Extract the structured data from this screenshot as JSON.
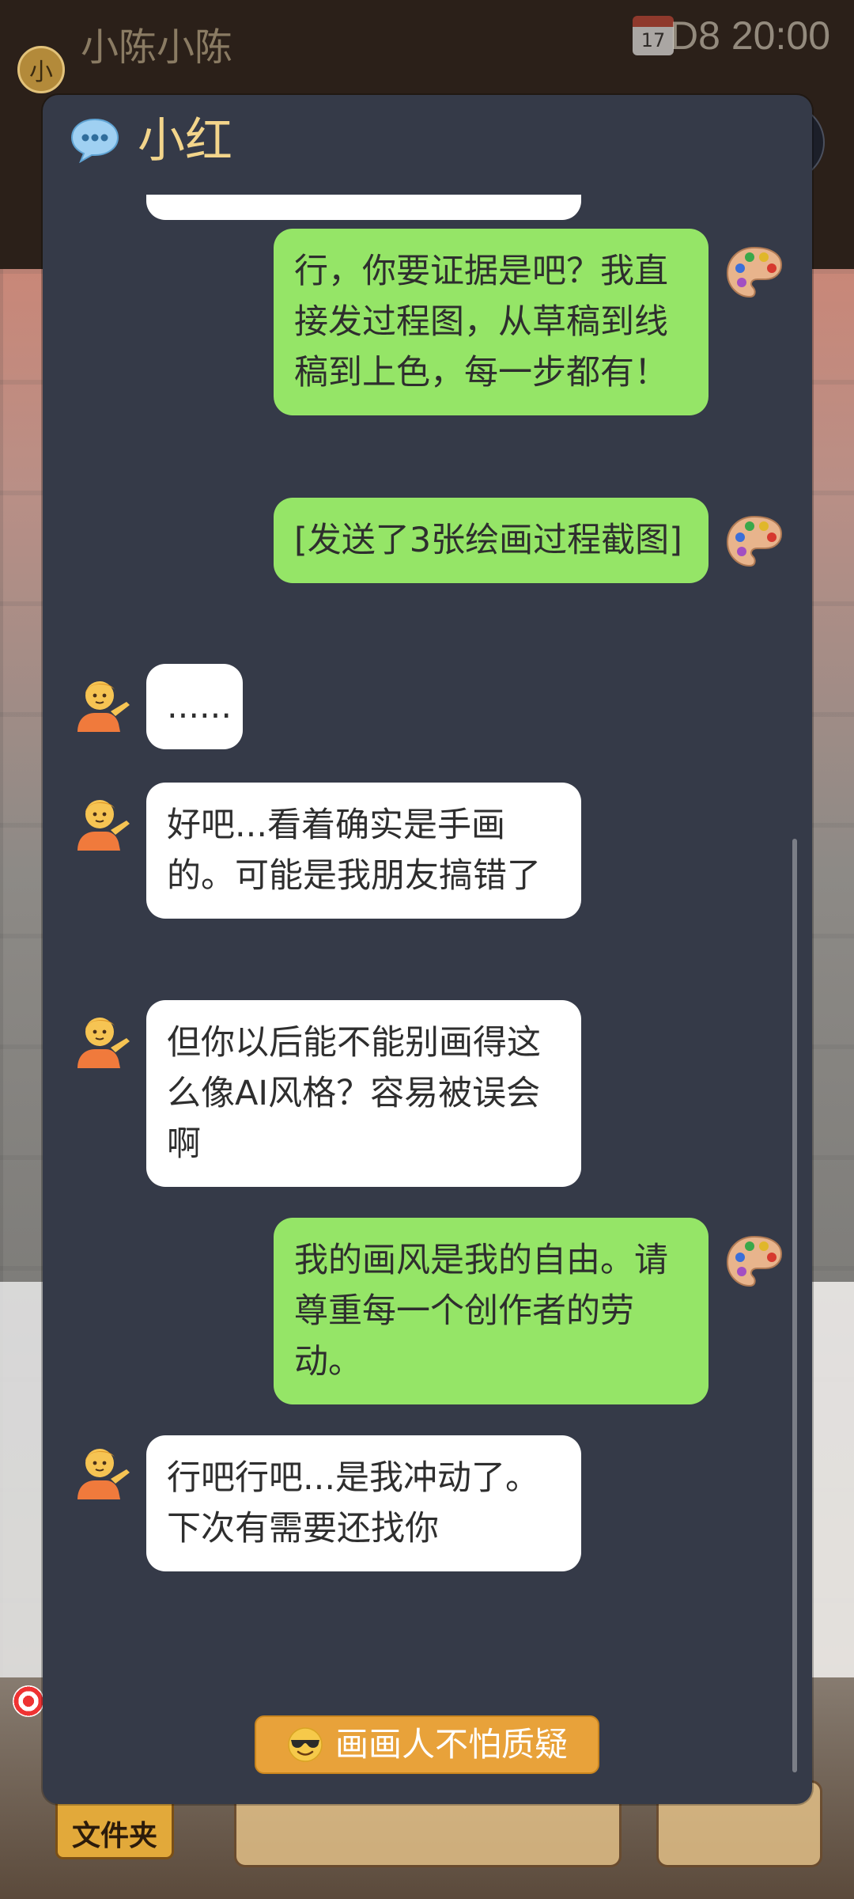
{
  "background": {
    "avatar_char": "小",
    "username": "小陈小陈",
    "calendar_day": "17",
    "day_label": "D8",
    "clock": "20:00",
    "folder_label": "文件夹"
  },
  "dialog": {
    "title": "小红",
    "icon": "speech-bubble-icon",
    "messages": [
      {
        "from": "me",
        "text": "行，你要证据是吧？我直接发过程图，从草稿到线稿到上色，每一步都有！"
      },
      {
        "from": "me",
        "text": "[发送了3张绘画过程截图]"
      },
      {
        "from": "them",
        "text": "......"
      },
      {
        "from": "them",
        "text": "好吧...看着确实是手画的。可能是我朋友搞错了"
      },
      {
        "from": "them",
        "text": "但你以后能不能别画得这么像AI风格？容易被误会啊"
      },
      {
        "from": "me",
        "text": "我的画风是我的自由。请尊重每一个创作者的劳动。"
      },
      {
        "from": "them",
        "text": "行吧行吧...是我冲动了。下次有需要还找你"
      }
    ],
    "my_avatar_icon": "artist-palette-icon",
    "their_avatar_icon": "person-tipping-hand-icon"
  },
  "action_button": {
    "icon": "smiling-face-with-sunglasses-icon",
    "label": "画画人不怕质疑"
  },
  "colors": {
    "dialog_bg": "#353a48",
    "my_bubble": "#95e567",
    "their_bubble": "#ffffff",
    "title": "#f3d58b",
    "action_button": "#e8a23a"
  }
}
